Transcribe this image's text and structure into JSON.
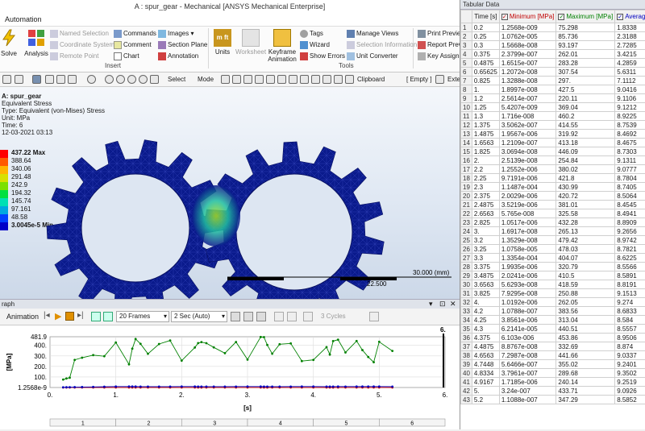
{
  "window": {
    "title": "A : spur_gear - Mechanical [ANSYS Mechanical Enterprise]"
  },
  "menu": {
    "active_tab": "Automation"
  },
  "ribbon": {
    "solve": "Solve",
    "analysis": "Analysis",
    "insert_group": "Insert",
    "tools_group": "Tools",
    "named_selection": "Named Selection",
    "coordinate_system": "Coordinate System",
    "remote_point": "Remote Point",
    "commands": "Commands",
    "comment": "Comment",
    "chart": "Chart",
    "images": "Images",
    "section_plane": "Section Plane",
    "annotation": "Annotation",
    "units": "Units",
    "worksheet": "Worksheet",
    "keyframe": "Keyframe Animation",
    "tags": "Tags",
    "wizard": "Wizard",
    "show_errors": "Show Errors",
    "manage_views": "Manage Views",
    "selection_information": "Selection Information",
    "unit_converter": "Unit Converter",
    "print_preview": "Print Preview",
    "report_preview": "Report Preview",
    "key_assignments": "Key Assignm"
  },
  "toolbar": {
    "select": "Select",
    "mode": "Mode",
    "clipboard": "Clipboard",
    "empty": "[ Empty ]",
    "extend": "Exte"
  },
  "result": {
    "header": [
      "A: spur_gear",
      "Equivalent Stress",
      "Type: Equivalent (von-Mises) Stress",
      "Unit: MPa",
      "Time: 6",
      "12-03-2021 03:13"
    ],
    "legend": [
      "437.22 Max",
      "388.64",
      "340.06",
      "291.48",
      "242.9",
      "194.32",
      "145.74",
      "97.161",
      "48.58",
      "3.0045e-5 Min"
    ],
    "legend_colors": [
      "#ff0000",
      "#ff5a00",
      "#ffb400",
      "#d8e000",
      "#7be000",
      "#00e040",
      "#00e0b4",
      "#00a8e0",
      "#0040ff",
      "#0000c8"
    ],
    "scale1": "30.000 (mm)",
    "scale2": "22.500"
  },
  "graph": {
    "panel_title": "raph",
    "animation": "Animation",
    "frames": "20 Frames",
    "duration": "2 Sec (Auto)",
    "cycles": "3 Cycles",
    "xaxis_label": "[s]",
    "yaxis_label": "[MPa]",
    "yticks": [
      "481.9",
      "400.",
      "300.",
      "200.",
      "100.",
      "1.2568e-9"
    ],
    "xticks": [
      "0.",
      "1.",
      "2.",
      "3.",
      "4.",
      "5.",
      "6."
    ],
    "marker": "6.",
    "timeline": [
      "1",
      "2",
      "3",
      "4",
      "5",
      "6"
    ]
  },
  "chart_data": {
    "type": "line",
    "xlabel": "[s]",
    "ylabel": "[MPa]",
    "xlim": [
      0,
      6
    ],
    "ylim": [
      1.2568e-09,
      481.9
    ],
    "series": [
      {
        "name": "Minimum [MPa]",
        "color": "#c00000",
        "values": [
          1.2568e-09,
          1.0762e-05,
          1.5668e-08,
          2.3799e-07,
          1.6515e-07,
          1.2072e-08,
          1.3288e-08,
          1.8997e-08,
          2.5614e-07,
          5.4207e-09,
          1.716e-08,
          3.5062e-07,
          1.9567e-06,
          1.2109e-07,
          3.0694e-08,
          2.5139e-08,
          1.2552e-06,
          9.7191e-06,
          0.00011487,
          2.0029e-06,
          3.5219e-06,
          5.765e-08,
          1.0517e-06,
          1.6917e-08,
          1.3529e-08,
          1.0758e-05,
          0.00013354,
          1.9935e-06,
          2.0241e-06,
          5.6293e-08,
          7.9295e-08,
          1.0192e-06,
          1.0788e-07,
          3.8561e-06,
          6.2141e-05,
          6.103e-06,
          8.8767e-08,
          7.2987e-08,
          5.6466e-07,
          3.7961e-07,
          1.7185e-06,
          3.24e-07,
          1.1088e-07
        ]
      },
      {
        "name": "Maximum [MPa]",
        "color": "#008000",
        "values": [
          75.298,
          85.736,
          93.197,
          262.01,
          283.28,
          307.54,
          297.0,
          427.5,
          220.11,
          369.04,
          460.2,
          414.55,
          319.92,
          413.18,
          446.09,
          254.84,
          380.02,
          421.8,
          430.99,
          420.72,
          381.01,
          325.58,
          432.28,
          265.13,
          479.42,
          478.03,
          404.07,
          320.79,
          410.5,
          418.59,
          250.88,
          262.05,
          383.56,
          313.04,
          440.51,
          453.86,
          332.69,
          441.66,
          355.02,
          289.68,
          240.14,
          433.71,
          347.29
        ]
      },
      {
        "name": "Average [MPa]",
        "color": "#0000c0",
        "values": [
          1.8338,
          2.3188,
          2.7285,
          3.4215,
          4.2859,
          5.6311,
          7.1112,
          9.0416,
          9.1106,
          9.1212,
          8.9225,
          8.7539,
          8.4692,
          8.4675,
          8.7303,
          9.1311,
          9.0777,
          8.7804,
          8.7405,
          8.5064,
          8.4545,
          8.4941,
          8.8909,
          9.2656,
          8.9742,
          8.7821,
          8.6225,
          8.5566,
          8.5891,
          8.8191,
          9.1513,
          9.274,
          8.6833,
          8.584,
          8.5557,
          8.9506,
          8.874,
          9.0337,
          9.2401,
          9.3502,
          9.2519,
          9.0926,
          8.5852
        ]
      }
    ],
    "x": [
      0.2,
      0.25,
      0.3,
      0.375,
      0.4875,
      0.65625,
      0.825,
      1.0,
      1.2,
      1.25,
      1.3,
      1.375,
      1.4875,
      1.6563,
      1.825,
      2.0,
      2.2,
      2.25,
      2.3,
      2.375,
      2.4875,
      2.6563,
      2.825,
      3.0,
      3.2,
      3.25,
      3.3,
      3.375,
      3.4875,
      3.6563,
      3.825,
      4.0,
      4.2,
      4.25,
      4.3,
      4.375,
      4.4875,
      4.6563,
      4.7448,
      4.8334,
      4.9167,
      5.0,
      5.2
    ]
  },
  "table": {
    "title": "Tabular Data",
    "headers": [
      "Time [s]",
      "Minimum [MPa]",
      "Maximum [MPa]",
      "Average"
    ],
    "rows": [
      [
        "1",
        "0.2",
        "1.2568e-009",
        "75.298",
        "1.8338"
      ],
      [
        "2",
        "0.25",
        "1.0762e-005",
        "85.736",
        "2.3188"
      ],
      [
        "3",
        "0.3",
        "1.5668e-008",
        "93.197",
        "2.7285"
      ],
      [
        "4",
        "0.375",
        "2.3799e-007",
        "262.01",
        "3.4215"
      ],
      [
        "5",
        "0.4875",
        "1.6515e-007",
        "283.28",
        "4.2859"
      ],
      [
        "6",
        "0.65625",
        "1.2072e-008",
        "307.54",
        "5.6311"
      ],
      [
        "7",
        "0.825",
        "1.3288e-008",
        "297.",
        "7.1112"
      ],
      [
        "8",
        "1.",
        "1.8997e-008",
        "427.5",
        "9.0416"
      ],
      [
        "9",
        "1.2",
        "2.5614e-007",
        "220.11",
        "9.1106"
      ],
      [
        "10",
        "1.25",
        "5.4207e-009",
        "369.04",
        "9.1212"
      ],
      [
        "11",
        "1.3",
        "1.716e-008",
        "460.2",
        "8.9225"
      ],
      [
        "12",
        "1.375",
        "3.5062e-007",
        "414.55",
        "8.7539"
      ],
      [
        "13",
        "1.4875",
        "1.9567e-006",
        "319.92",
        "8.4692"
      ],
      [
        "14",
        "1.6563",
        "1.2109e-007",
        "413.18",
        "8.4675"
      ],
      [
        "15",
        "1.825",
        "3.0694e-008",
        "446.09",
        "8.7303"
      ],
      [
        "16",
        "2.",
        "2.5139e-008",
        "254.84",
        "9.1311"
      ],
      [
        "17",
        "2.2",
        "1.2552e-006",
        "380.02",
        "9.0777"
      ],
      [
        "18",
        "2.25",
        "9.7191e-006",
        "421.8",
        "8.7804"
      ],
      [
        "19",
        "2.3",
        "1.1487e-004",
        "430.99",
        "8.7405"
      ],
      [
        "20",
        "2.375",
        "2.0029e-006",
        "420.72",
        "8.5064"
      ],
      [
        "21",
        "2.4875",
        "3.5219e-006",
        "381.01",
        "8.4545"
      ],
      [
        "22",
        "2.6563",
        "5.765e-008",
        "325.58",
        "8.4941"
      ],
      [
        "23",
        "2.825",
        "1.0517e-006",
        "432.28",
        "8.8909"
      ],
      [
        "24",
        "3.",
        "1.6917e-008",
        "265.13",
        "9.2656"
      ],
      [
        "25",
        "3.2",
        "1.3529e-008",
        "479.42",
        "8.9742"
      ],
      [
        "26",
        "3.25",
        "1.0758e-005",
        "478.03",
        "8.7821"
      ],
      [
        "27",
        "3.3",
        "1.3354e-004",
        "404.07",
        "8.6225"
      ],
      [
        "28",
        "3.375",
        "1.9935e-006",
        "320.79",
        "8.5566"
      ],
      [
        "29",
        "3.4875",
        "2.0241e-006",
        "410.5",
        "8.5891"
      ],
      [
        "30",
        "3.6563",
        "5.6293e-008",
        "418.59",
        "8.8191"
      ],
      [
        "31",
        "3.825",
        "7.9295e-008",
        "250.88",
        "9.1513"
      ],
      [
        "32",
        "4.",
        "1.0192e-006",
        "262.05",
        "9.274"
      ],
      [
        "33",
        "4.2",
        "1.0788e-007",
        "383.56",
        "8.6833"
      ],
      [
        "34",
        "4.25",
        "3.8561e-006",
        "313.04",
        "8.584"
      ],
      [
        "35",
        "4.3",
        "6.2141e-005",
        "440.51",
        "8.5557"
      ],
      [
        "36",
        "4.375",
        "6.103e-006",
        "453.86",
        "8.9506"
      ],
      [
        "37",
        "4.4875",
        "8.8767e-008",
        "332.69",
        "8.874"
      ],
      [
        "38",
        "4.6563",
        "7.2987e-008",
        "441.66",
        "9.0337"
      ],
      [
        "39",
        "4.7448",
        "5.6466e-007",
        "355.02",
        "9.2401"
      ],
      [
        "40",
        "4.8334",
        "3.7961e-007",
        "289.68",
        "9.3502"
      ],
      [
        "41",
        "4.9167",
        "1.7185e-006",
        "240.14",
        "9.2519"
      ],
      [
        "42",
        "5.",
        "3.24e-007",
        "433.71",
        "9.0926"
      ],
      [
        "43",
        "5.2",
        "1.1088e-007",
        "347.29",
        "8.5852"
      ]
    ]
  }
}
